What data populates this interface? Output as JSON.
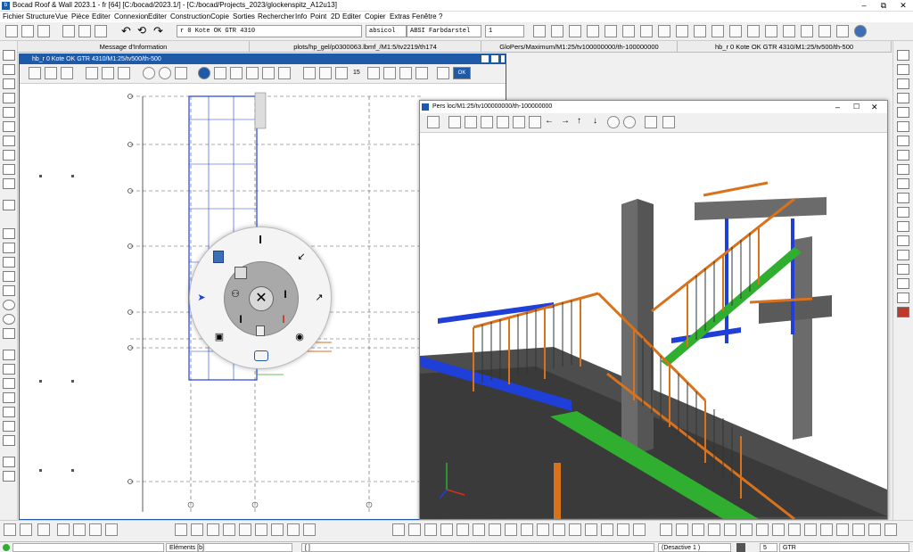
{
  "titlebar": {
    "title": "Bocad Roof & Wall 2023.1 - fr [64]  [C:/bocad/2023.1/]  - [C:/bocad/Projects_2023/glockenspitz_A12u13]",
    "restore": "⧉",
    "close": "✕"
  },
  "menu": [
    "Fichier",
    "Structure",
    "Vue",
    "Pièce",
    "Editer",
    "Connexion",
    "Editer",
    "Construction",
    "Copie",
    "Sorties",
    "Rechercher",
    "Info",
    "Point",
    "2D",
    "Editer",
    "Copier",
    "Extras",
    "Fenêtre",
    "?"
  ],
  "toolbar": {
    "combo_kote": "r 0 Kote OK GTR 4310",
    "combo_absicol": "absicol",
    "combo_farb": "ABSI Farbdarstel",
    "combo_one": "1"
  },
  "doc_tabs": [
    "Message d'Information",
    "plots/hp_gel/p0300063.lbmf_/M1:5/tv2219/th174",
    "GloPers/Maximum/M1:25/tv100000000/th-100000000",
    "hb_r 0 Kote OK GTR 4310/M1:25/tv500/th-500"
  ],
  "plan": {
    "title": "hb_r 0 Kote OK GTR 4310/M1:25/tv500/th-500",
    "zoom_value": "15",
    "ok_label": "OK"
  },
  "view3d": {
    "title": "Pers loc/M1:25/tv100000000/th-100000000"
  },
  "status": {
    "elements": "Eléments [b]",
    "bracket": "[ ]",
    "mode": "(Desactive 1 )",
    "num": "5",
    "unit": "GTR"
  },
  "colors": {
    "accent": "#1e5aa8",
    "steel_blue": "#1e3fd8",
    "green": "#2fae2f",
    "orange": "#d9721c",
    "concrete": "#6b6b6b"
  }
}
